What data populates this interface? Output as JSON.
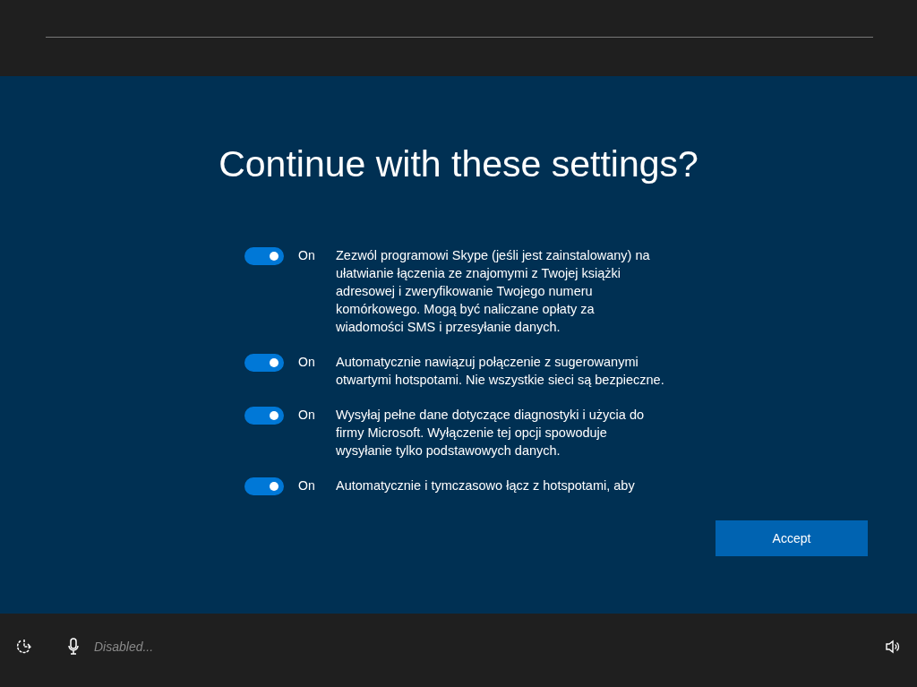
{
  "title": "Continue with these settings?",
  "settings": [
    {
      "on": true,
      "state_label": "On",
      "description": "Zezwól programowi Skype (jeśli jest zainstalowany) na ułatwianie łączenia ze znajomymi z Twojej książki adresowej i zweryfikowanie Twojego numeru komórkowego. Mogą być naliczane opłaty za wiadomości SMS i przesyłanie danych."
    },
    {
      "on": true,
      "state_label": "On",
      "description": "Automatycznie nawiązuj połączenie z sugerowanymi otwartymi hotspotami. Nie wszystkie sieci są bezpieczne."
    },
    {
      "on": true,
      "state_label": "On",
      "description": "Wysyłaj pełne dane dotyczące diagnostyki i użycia do firmy Microsoft. Wyłączenie tej opcji spowoduje wysyłanie tylko podstawowych danych."
    },
    {
      "on": true,
      "state_label": "On",
      "description": "Automatycznie i tymczasowo łącz z hotspotami, aby"
    }
  ],
  "accept_button": "Accept",
  "footer": {
    "mic_status": "Disabled..."
  }
}
